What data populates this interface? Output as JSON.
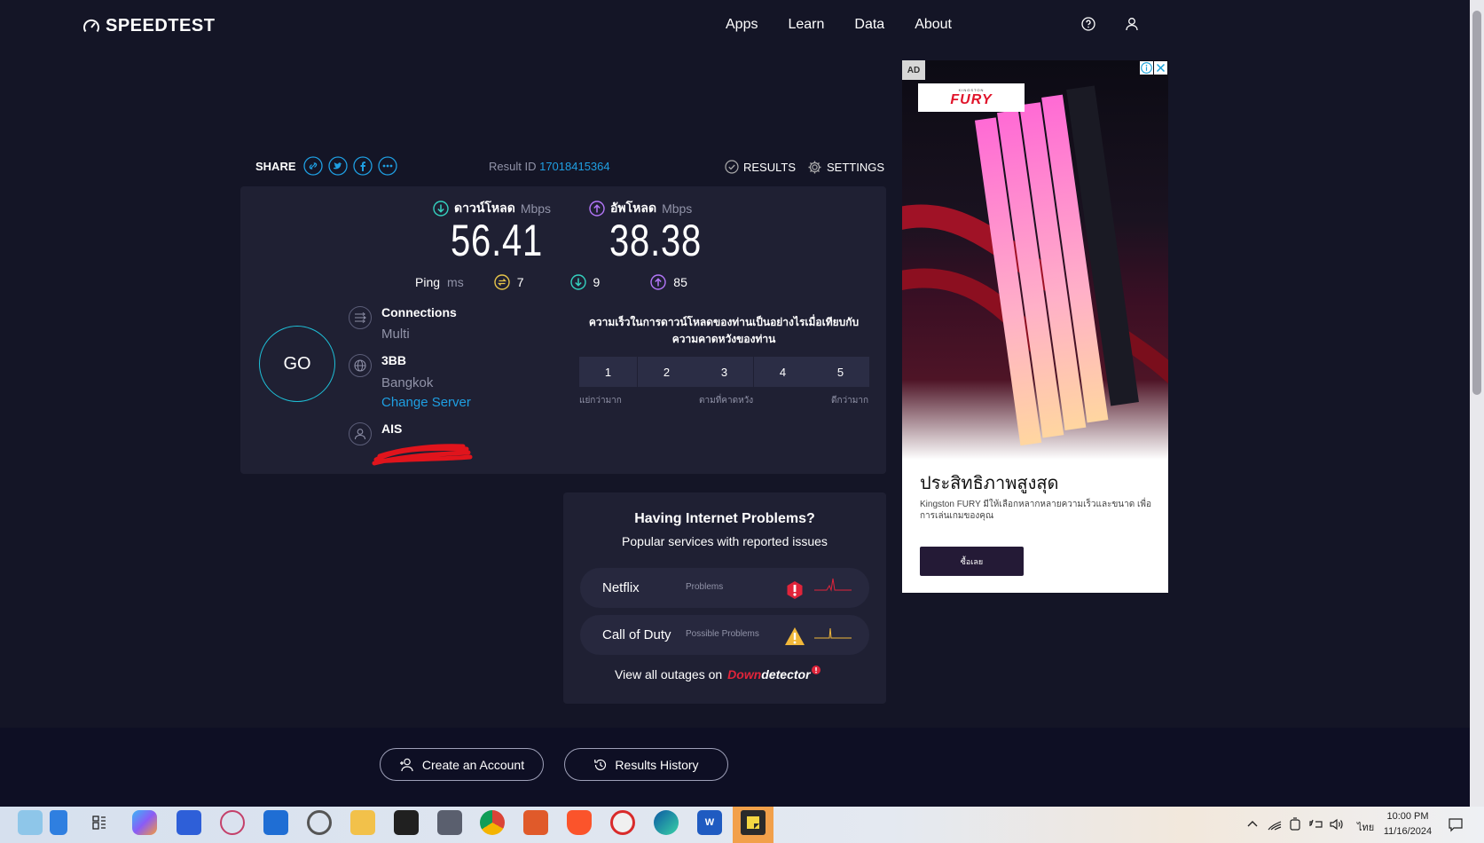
{
  "header": {
    "logo_text": "SPEEDTEST",
    "nav": [
      "Apps",
      "Learn",
      "Data",
      "About"
    ]
  },
  "toolbar": {
    "share_label": "SHARE",
    "result_label": "Result ID",
    "result_id": "17018415364",
    "results_label": "RESULTS",
    "settings_label": "SETTINGS"
  },
  "speeds": {
    "download_label": "ดาวน์โหลด",
    "download_unit": "Mbps",
    "download_value": "56.41",
    "upload_label": "อัพโหลด",
    "upload_unit": "Mbps",
    "upload_value": "38.38"
  },
  "ping": {
    "label": "Ping",
    "unit": "ms",
    "idle": "7",
    "download": "9",
    "upload": "85"
  },
  "go_label": "GO",
  "connections": {
    "title": "Connections",
    "value": "Multi"
  },
  "server": {
    "name": "3BB",
    "location": "Bangkok",
    "change_label": "Change Server"
  },
  "provider": {
    "name": "AIS"
  },
  "rating": {
    "question": "ความเร็วในการดาวน์โหลดของท่านเป็นอย่างไรเมื่อเทียบกับความคาดหวังของท่าน",
    "options": [
      "1",
      "2",
      "3",
      "4",
      "5"
    ],
    "low_label": "แย่กว่ามาก",
    "mid_label": "ตามที่คาดหวัง",
    "high_label": "ดีกว่ามาก"
  },
  "problems": {
    "title": "Having Internet Problems?",
    "subtitle": "Popular services with reported issues",
    "services": [
      {
        "name": "Netflix",
        "status": "Problems"
      },
      {
        "name": "Call of Duty",
        "status": "Possible Problems"
      }
    ],
    "view_all": "View all outages on",
    "brand_down": "Down",
    "brand_detector": "detector"
  },
  "ad": {
    "badge": "AD",
    "brand_small": "KINGSTON",
    "brand": "FURY",
    "headline": "ประสิทธิภาพสูงสุด",
    "body": "Kingston FURY มีให้เลือกหลากหลายความเร็วและขนาด เพื่อการเล่นเกมของคุณ",
    "cta": "ซื้อเลย"
  },
  "footer": {
    "create_account": "Create an Account",
    "results_history": "Results History"
  },
  "taskbar": {
    "time": "10:00 PM",
    "date": "11/16/2024",
    "language": "ไทย"
  }
}
